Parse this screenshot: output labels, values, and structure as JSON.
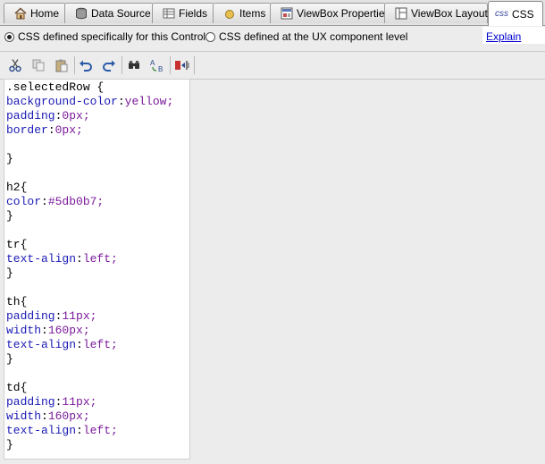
{
  "tabs": [
    {
      "label": "Home",
      "icon": "home-icon",
      "active": false
    },
    {
      "label": "Data Source",
      "icon": "database-icon",
      "active": false
    },
    {
      "label": "Fields",
      "icon": "fields-icon",
      "active": false
    },
    {
      "label": "Items",
      "icon": "items-icon",
      "active": false
    },
    {
      "label": "ViewBox Properties",
      "icon": "properties-icon",
      "active": false
    },
    {
      "label": "ViewBox Layout",
      "icon": "layout-icon",
      "active": false
    },
    {
      "label": "CSS",
      "icon": "css-icon",
      "icon_text": "css",
      "active": true
    }
  ],
  "options": {
    "control_label": "CSS defined specifically for this Control",
    "component_label": "CSS defined at the UX component level",
    "selected": "control",
    "explain_link": "Explain"
  },
  "toolbar": {
    "buttons": [
      "cut-icon",
      "copy-icon",
      "paste-icon",
      "undo-icon",
      "redo-icon",
      "find-icon",
      "replace-icon",
      "insert-icon"
    ]
  },
  "editor": {
    "lines": [
      {
        "type": "selector",
        "text": ".selectedRow {"
      },
      {
        "type": "decl",
        "prop": "background-color",
        "val": "yellow;"
      },
      {
        "type": "decl",
        "prop": "padding",
        "val": "0px;"
      },
      {
        "type": "decl",
        "prop": "border",
        "val": "0px;"
      },
      {
        "type": "blank",
        "text": ""
      },
      {
        "type": "selector",
        "text": "}"
      },
      {
        "type": "blank",
        "text": ""
      },
      {
        "type": "selector",
        "text": "h2{"
      },
      {
        "type": "decl",
        "prop": "color",
        "val": "#5db0b7;"
      },
      {
        "type": "selector",
        "text": "}"
      },
      {
        "type": "blank",
        "text": ""
      },
      {
        "type": "selector",
        "text": "tr{"
      },
      {
        "type": "decl",
        "prop": "text-align",
        "val": "left;"
      },
      {
        "type": "selector",
        "text": "}"
      },
      {
        "type": "blank",
        "text": ""
      },
      {
        "type": "selector",
        "text": "th{"
      },
      {
        "type": "decl",
        "prop": "padding",
        "val": "11px;"
      },
      {
        "type": "decl",
        "prop": "width",
        "val": "160px;"
      },
      {
        "type": "decl",
        "prop": "text-align",
        "val": "left;"
      },
      {
        "type": "selector",
        "text": "}"
      },
      {
        "type": "blank",
        "text": ""
      },
      {
        "type": "selector",
        "text": "td{"
      },
      {
        "type": "decl",
        "prop": "padding",
        "val": "11px;"
      },
      {
        "type": "decl",
        "prop": "width",
        "val": "160px;"
      },
      {
        "type": "decl",
        "prop": "text-align",
        "val": "left;"
      },
      {
        "type": "selector",
        "text": "}"
      }
    ]
  }
}
